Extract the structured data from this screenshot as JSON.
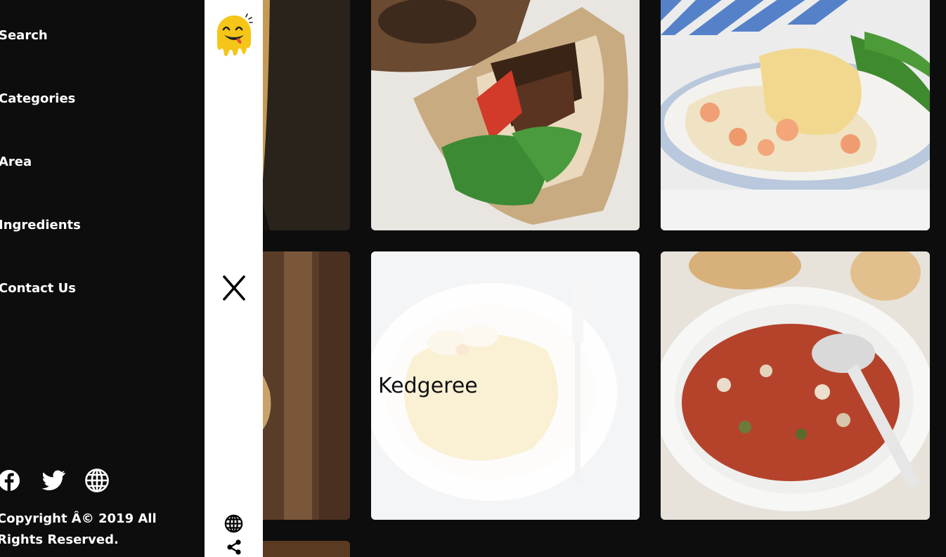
{
  "side_nav": {
    "links": [
      "Search",
      "Categories",
      "Area",
      "Ingredients",
      "Contact Us"
    ],
    "social_icons": [
      "facebook-icon",
      "twitter-icon",
      "globe-icon"
    ],
    "copyright": "Copyright Â© 2019 All Rights Reserved."
  },
  "strip": {
    "logo_icon": "smiley-logo-icon",
    "close_icon": "close-icon",
    "globe_icon": "globe-icon",
    "share_icon": "share-icon"
  },
  "meals": [
    {
      "name": "",
      "photo": "baked-gratin-skillet"
    },
    {
      "name": "",
      "photo": "chicken-wrap"
    },
    {
      "name": "",
      "photo": "fish-pie-green-beans"
    },
    {
      "name": "",
      "photo": "leek-quiche-wooden-board"
    },
    {
      "name": "Kedgeree",
      "photo": "kedgeree-plate"
    },
    {
      "name": "",
      "photo": "bean-soup-bowl"
    },
    {
      "name": "",
      "photo": "partial-dish"
    }
  ],
  "colors": {
    "background": "#0d0d0d",
    "strip": "#ffffff",
    "logo_yellow": "#f5c518",
    "overlay": "rgba(255,255,255,0.78)"
  }
}
